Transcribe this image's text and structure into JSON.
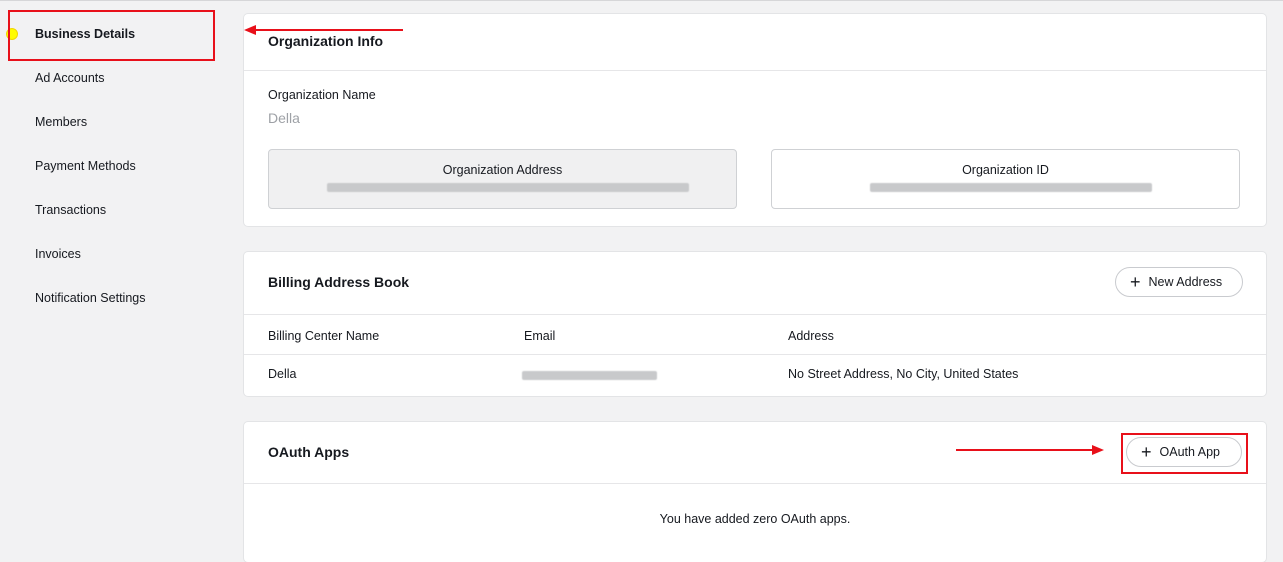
{
  "sidebar": {
    "items": [
      {
        "label": "Business Details"
      },
      {
        "label": "Ad Accounts"
      },
      {
        "label": "Members"
      },
      {
        "label": "Payment Methods"
      },
      {
        "label": "Transactions"
      },
      {
        "label": "Invoices"
      },
      {
        "label": "Notification Settings"
      }
    ]
  },
  "org_info": {
    "title": "Organization Info",
    "name_label": "Organization Name",
    "name_value": "Della",
    "address_label": "Organization Address",
    "id_label": "Organization ID"
  },
  "billing": {
    "title": "Billing Address Book",
    "new_button": "New Address",
    "columns": [
      "Billing Center Name",
      "Email",
      "Address"
    ],
    "rows": [
      {
        "name": "Della",
        "address": "No Street Address, No City, United States"
      }
    ]
  },
  "oauth": {
    "title": "OAuth Apps",
    "add_button": "OAuth App",
    "empty_text": "You have added zero OAuth apps."
  },
  "colors": {
    "annotation": "#e8101a",
    "active_dot": "#fffc00"
  }
}
